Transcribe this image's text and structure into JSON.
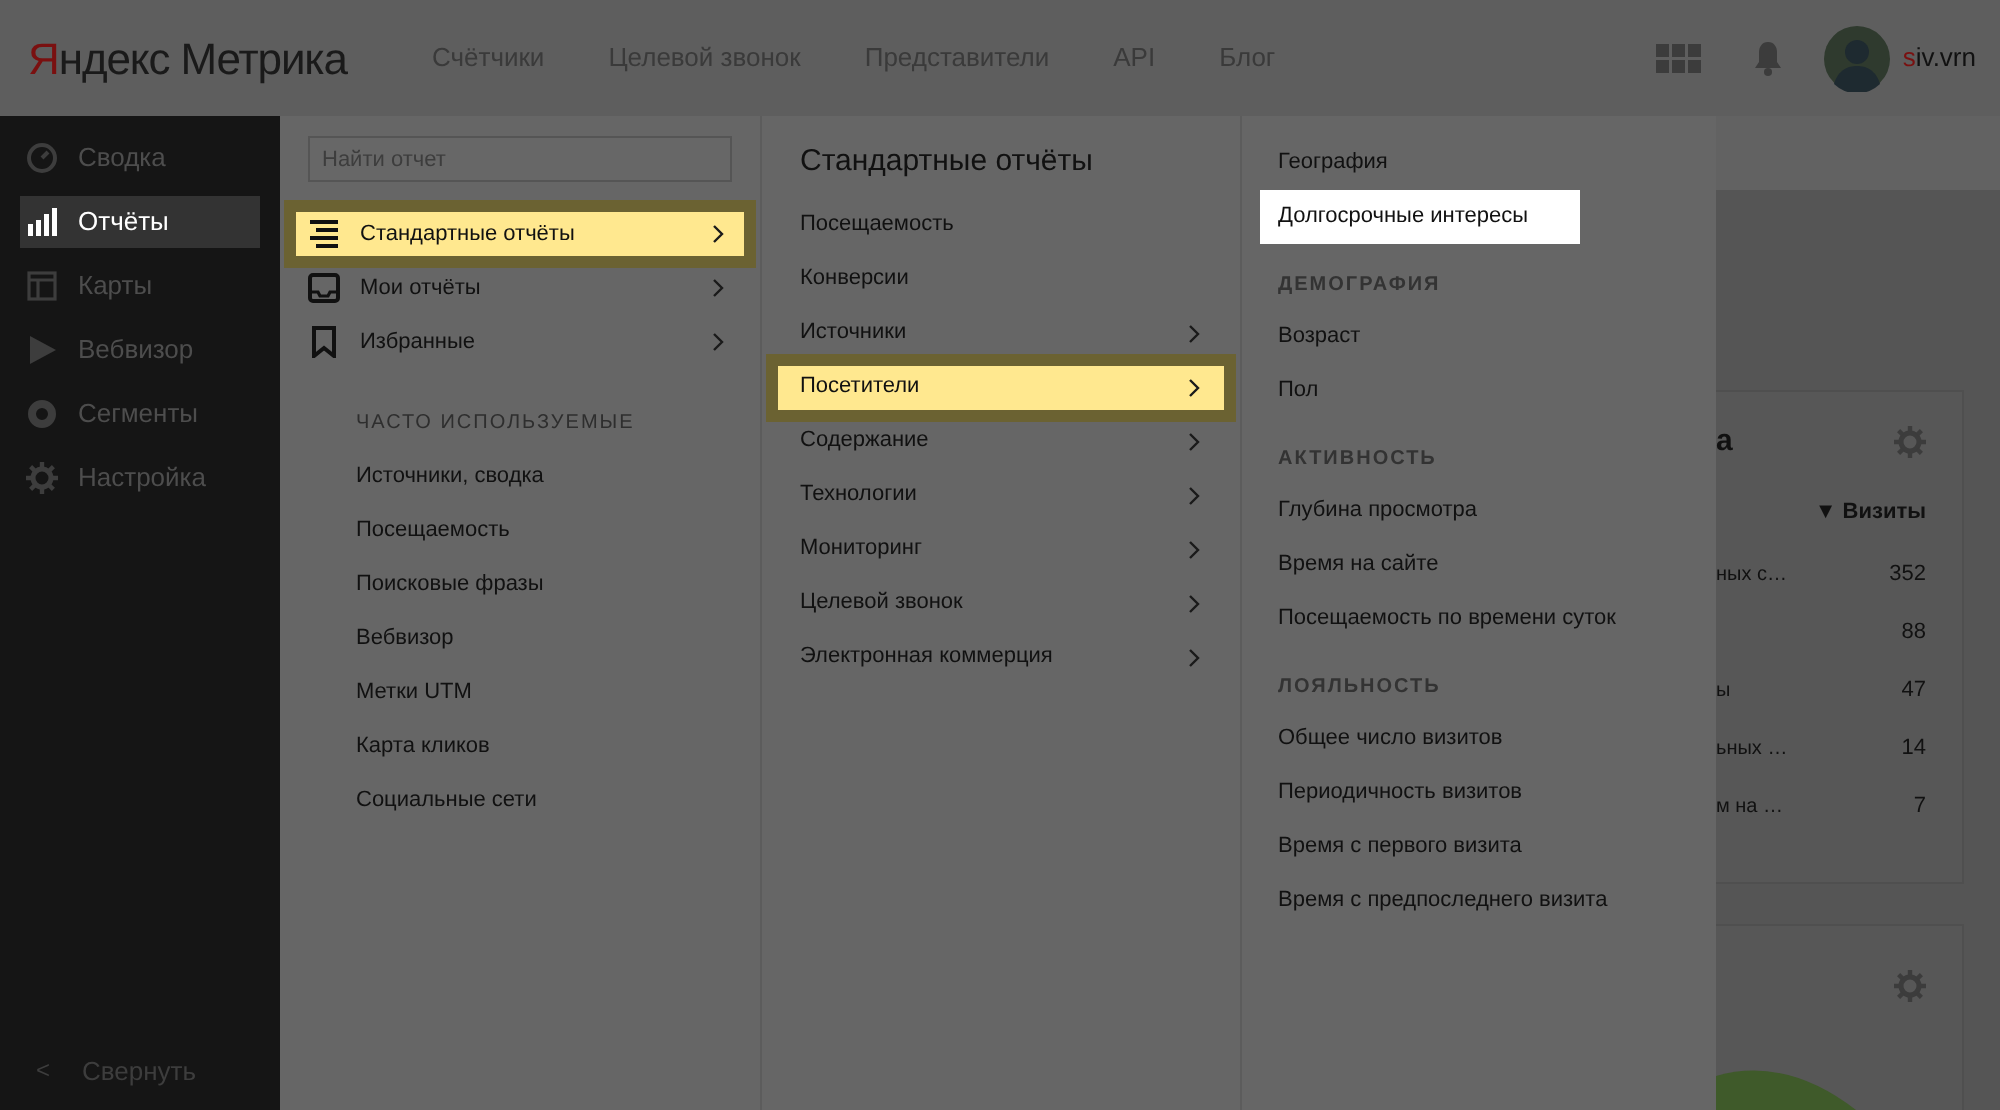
{
  "header": {
    "logo": {
      "accent": "Я",
      "rest": "ндекс Метрика"
    },
    "nav": [
      "Счётчики",
      "Целевой звонок",
      "Представители",
      "API",
      "Блог"
    ],
    "user": {
      "accent": "s",
      "rest": "iv.vrn"
    }
  },
  "sidebar": {
    "items": [
      {
        "kind": "gauge",
        "label": "Сводка",
        "selected": false
      },
      {
        "kind": "bars",
        "label": "Отчёты",
        "selected": true
      },
      {
        "kind": "layout",
        "label": "Карты",
        "selected": false
      },
      {
        "kind": "play",
        "label": "Вебвизор",
        "selected": false
      },
      {
        "kind": "ring",
        "label": "Сегменты",
        "selected": false
      },
      {
        "kind": "gear",
        "label": "Настройка",
        "selected": false
      }
    ],
    "collapse": {
      "icon": "<",
      "label": "Свернуть"
    }
  },
  "reports_menu": {
    "search": {
      "placeholder": "Найти отчет"
    },
    "items": [
      {
        "kind": "list",
        "label": "Стандартные отчёты",
        "selected": true
      },
      {
        "kind": "tray",
        "label": "Мои отчёты",
        "selected": false
      },
      {
        "kind": "bookmark",
        "label": "Избранные",
        "selected": false
      }
    ],
    "frequent_heading": "ЧАСТО ИСПОЛЬЗУЕМЫЕ",
    "frequent": [
      "Источники, сводка",
      "Посещаемость",
      "Поисковые фразы",
      "Вебвизор",
      "Метки UTM",
      "Карта кликов",
      "Социальные сети"
    ]
  },
  "standard_menu": {
    "title": "Стандартные отчёты",
    "items": [
      {
        "label": "Посещаемость",
        "submenu": false,
        "selected": false
      },
      {
        "label": "Конверсии",
        "submenu": false,
        "selected": false
      },
      {
        "label": "Источники",
        "submenu": true,
        "selected": false
      },
      {
        "label": "Посетители",
        "submenu": true,
        "selected": true
      },
      {
        "label": "Содержание",
        "submenu": true,
        "selected": false
      },
      {
        "label": "Технологии",
        "submenu": true,
        "selected": false
      },
      {
        "label": "Мониторинг",
        "submenu": true,
        "selected": false
      },
      {
        "label": "Целевой звонок",
        "submenu": true,
        "selected": false
      },
      {
        "label": "Электронная коммерция",
        "submenu": true,
        "selected": false
      }
    ]
  },
  "visitors_menu": {
    "groups": [
      {
        "items": [
          {
            "label": "География",
            "selected": false
          },
          {
            "label": "Долгосрочные интересы",
            "selected": true
          }
        ]
      },
      {
        "heading": "ДЕМОГРАФИЯ",
        "items": [
          {
            "label": "Возраст",
            "selected": false
          },
          {
            "label": "Пол",
            "selected": false
          }
        ]
      },
      {
        "heading": "АКТИВНОСТЬ",
        "items": [
          {
            "label": "Глубина просмотра",
            "selected": false
          },
          {
            "label": "Время на сайте",
            "selected": false
          },
          {
            "label": "Посещаемость по времени суток",
            "selected": false
          }
        ]
      },
      {
        "heading": "ЛОЯЛЬНОСТЬ",
        "items": [
          {
            "label": "Общее число визитов",
            "selected": false
          },
          {
            "label": "Периодичность визитов",
            "selected": false
          },
          {
            "label": "Время с первого визита",
            "selected": false
          },
          {
            "label": "Время с предпоследнего визита",
            "selected": false
          }
        ]
      }
    ]
  },
  "main": {
    "card": {
      "title": "а",
      "column": "▼ Визиты",
      "rows": [
        {
          "label": "ных с…",
          "value": "352"
        },
        {
          "value": "88"
        },
        {
          "label": "ы",
          "value": "47"
        },
        {
          "label": "ьных …",
          "value": "14"
        },
        {
          "label": "м на …",
          "value": "7"
        }
      ]
    }
  }
}
